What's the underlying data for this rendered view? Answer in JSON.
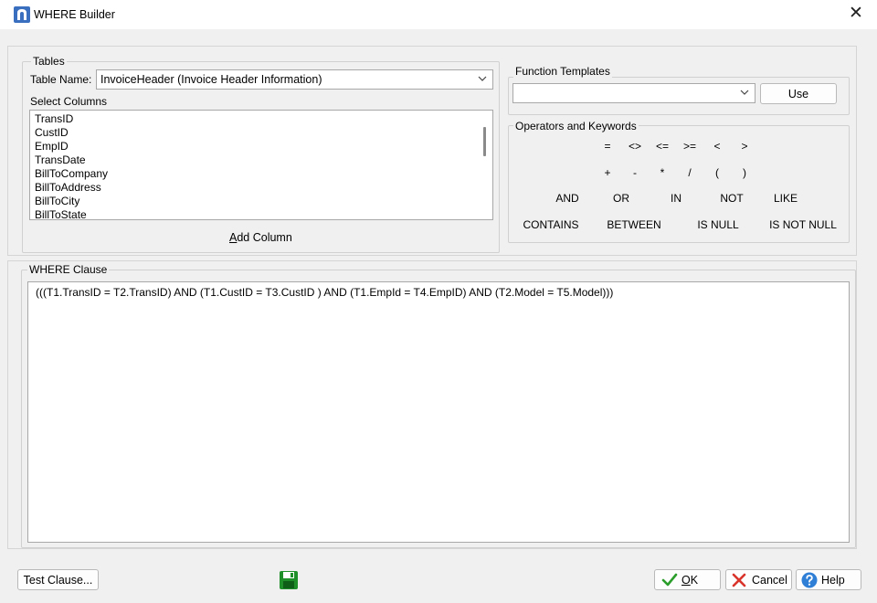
{
  "window": {
    "title": "WHERE Builder",
    "close_label": "✕"
  },
  "tables": {
    "group_label": "Tables",
    "table_name_label": "Table Name:",
    "table_name_value": "InvoiceHeader  (Invoice Header Information)",
    "select_columns_label": "Select Columns",
    "columns": [
      "TransID",
      "CustID",
      "EmpID",
      "TransDate",
      "BillToCompany",
      "BillToAddress",
      "BillToCity",
      "BillToState"
    ],
    "add_column_label": "Add Column",
    "add_column_mnemonic": "A",
    "add_column_rest": "dd Column"
  },
  "function_templates": {
    "group_label": "Function Templates",
    "selected_value": "",
    "use_label": "Use"
  },
  "operators": {
    "group_label": "Operators and Keywords",
    "row1": [
      "=",
      "<>",
      "<=",
      ">=",
      "<",
      ">"
    ],
    "row2": [
      "+",
      "-",
      "*",
      "/",
      "(",
      ")"
    ],
    "row3": [
      "AND",
      "OR",
      "IN",
      "NOT",
      "LIKE"
    ],
    "row4": [
      "CONTAINS",
      "BETWEEN",
      "IS NULL",
      "IS NOT NULL"
    ]
  },
  "where_clause": {
    "group_label": "WHERE Clause",
    "text": "(((T1.TransID = T2.TransID) AND (T1.CustID = T3.CustID ) AND  (T1.EmpId = T4.EmpID) AND (T2.Model = T5.Model)))"
  },
  "footer": {
    "test_clause_label": "Test Clause...",
    "ok_label": "OK",
    "ok_mnemonic": "O",
    "ok_rest": "K",
    "cancel_label": "Cancel",
    "help_label": "Help",
    "save_icon": "save-disk-icon",
    "colors": {
      "save": "#1f8f2a",
      "ok": "#2a9d2a",
      "cancel": "#d9342b",
      "help": "#2f7fd6"
    }
  }
}
